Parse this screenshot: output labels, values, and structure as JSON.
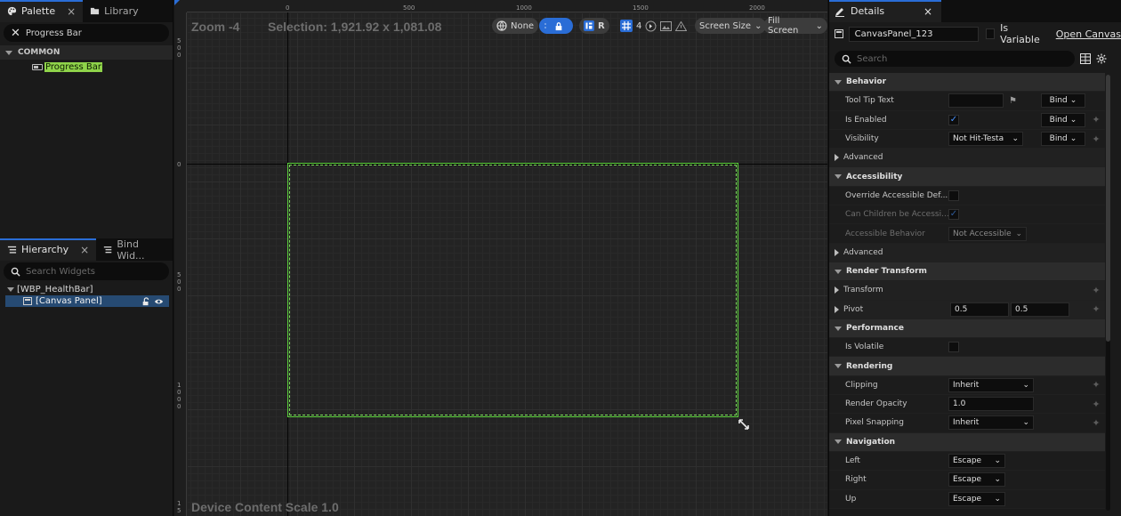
{
  "palette": {
    "tabs": [
      {
        "label": "Palette",
        "close": "×"
      },
      {
        "label": "Library"
      }
    ],
    "search_value": "Progress Bar",
    "section": "COMMON",
    "item": "Progress Bar"
  },
  "hierarchy": {
    "tabs": [
      {
        "label": "Hierarchy",
        "close": "×"
      },
      {
        "label": "Bind Wid..."
      }
    ],
    "search_placeholder": "Search Widgets",
    "root": "[WBP_HealthBar]",
    "child": "[Canvas Panel]"
  },
  "designer": {
    "zoom": "Zoom -4",
    "selection": "Selection: 1,921.92 x 1,081.08",
    "device_scale": "Device Content Scale 1.0",
    "ruler_top": [
      "0",
      "500",
      "1000",
      "1500",
      "2000"
    ],
    "ruler_left": [
      "5 0 0",
      "0",
      "5 0 0",
      "1 0 0 0",
      "1 5"
    ],
    "toolbar": {
      "none_label": "None",
      "r_label": "R",
      "grid_value": "4",
      "screen_size": "Screen Size",
      "fill_screen": "Fill Screen"
    },
    "canvas_color": "#5cd23c"
  },
  "details": {
    "tab": "Details",
    "tab_close": "×",
    "widget_name": "CanvasPanel_123",
    "is_variable": "Is Variable",
    "open_canvas": "Open Canvas",
    "search_placeholder": "Search",
    "rows": {
      "behavior": "Behavior",
      "tooltip": "Tool Tip Text",
      "is_enabled": "Is Enabled",
      "visibility": "Visibility",
      "visibility_value": "Not Hit-Testa",
      "advanced1": "Advanced",
      "accessibility": "Accessibility",
      "override_acc": "Override Accessible Def...",
      "children_acc": "Can Children be Accessi...",
      "acc_behavior": "Accessible Behavior",
      "acc_behavior_value": "Not Accessible",
      "advanced2": "Advanced",
      "render_transform": "Render Transform",
      "transform": "Transform",
      "pivot": "Pivot",
      "pivot_x": "0.5",
      "pivot_y": "0.5",
      "performance": "Performance",
      "is_volatile": "Is Volatile",
      "rendering": "Rendering",
      "clipping": "Clipping",
      "clipping_value": "Inherit",
      "render_opacity": "Render Opacity",
      "render_opacity_value": "1.0",
      "pixel_snapping": "Pixel Snapping",
      "pixel_snapping_value": "Inherit",
      "navigation": "Navigation",
      "left": "Left",
      "left_value": "Escape",
      "right": "Right",
      "right_value": "Escape",
      "up": "Up",
      "up_value": "Escape",
      "bind": "Bind"
    }
  }
}
